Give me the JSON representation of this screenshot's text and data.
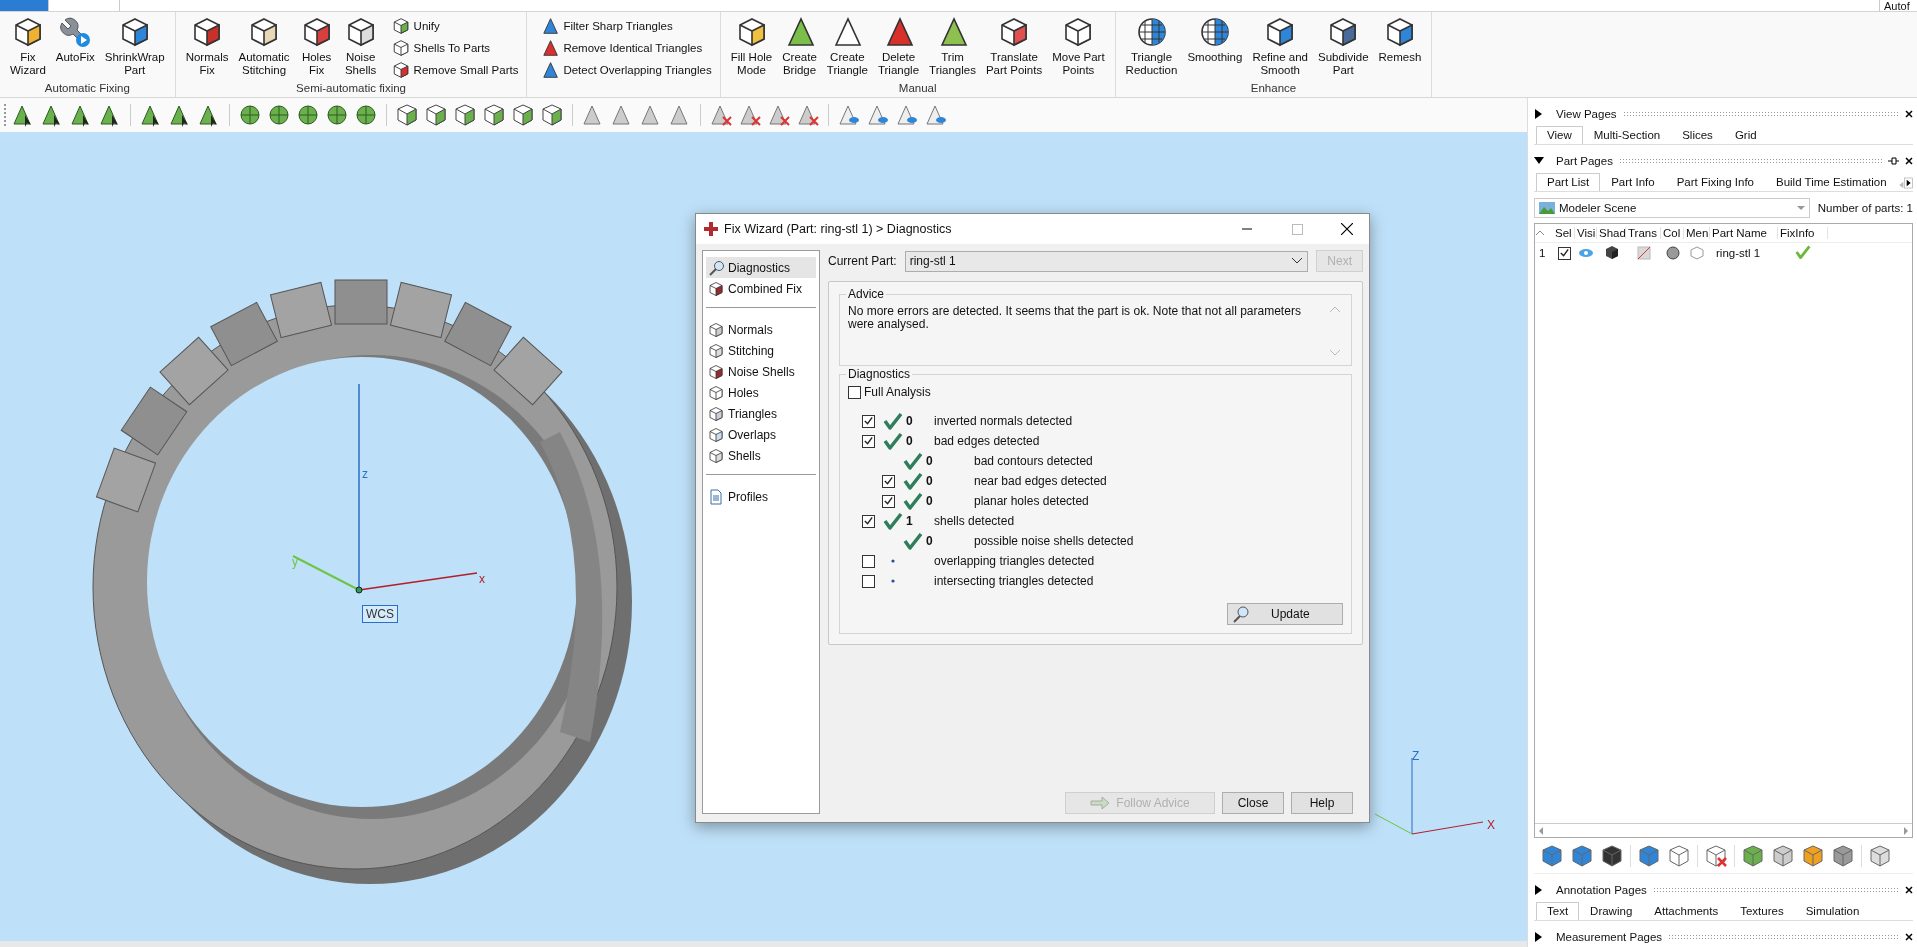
{
  "top_tab": "Autof",
  "ribbon": {
    "groups": [
      {
        "label": "Automatic Fixing",
        "buttons": [
          "Fix\nWizard",
          "AutoFix",
          "ShrinkWrap\nPart"
        ]
      },
      {
        "label": "Semi-automatic fixing",
        "buttons": [
          "Normals\nFix",
          "Automatic\nStitching",
          "Holes\nFix",
          "Noise\nShells"
        ],
        "small_buttons": [
          "Unify",
          "Shells To Parts",
          "Remove Small Parts"
        ]
      },
      {
        "small_buttons": [
          "Filter Sharp Triangles",
          "Remove Identical Triangles",
          "Detect Overlapping Triangles"
        ]
      },
      {
        "label": "Manual",
        "buttons": [
          "Fill Hole\nMode",
          "Create\nBridge",
          "Create\nTriangle",
          "Delete\nTriangle",
          "Trim\nTriangles",
          "Translate\nPart Points",
          "Move Part\nPoints"
        ]
      },
      {
        "label": "Enhance",
        "buttons": [
          "Triangle\nReduction",
          "Smoothing",
          "Refine and\nSmooth",
          "Subdivide\nPart",
          "Remesh"
        ]
      }
    ]
  },
  "viewport": {
    "axes": {
      "z": "z",
      "y": "y",
      "x": "x",
      "origin": "WCS"
    },
    "mini_axes": {
      "z": "Z",
      "x": "X"
    }
  },
  "fix_wizard": {
    "title": "Fix Wizard (Part: ring-stl 1) > Diagnostics",
    "nav_groups": [
      {
        "items": [
          {
            "label": "Diagnostics",
            "selected": true
          },
          {
            "label": "Combined Fix",
            "selected": false
          }
        ]
      },
      {
        "items": [
          {
            "label": "Normals",
            "selected": false
          },
          {
            "label": "Stitching",
            "selected": false
          },
          {
            "label": "Noise Shells",
            "selected": false
          },
          {
            "label": "Holes",
            "selected": false
          },
          {
            "label": "Triangles",
            "selected": false
          },
          {
            "label": "Overlaps",
            "selected": false
          },
          {
            "label": "Shells",
            "selected": false
          }
        ]
      },
      {
        "items": [
          {
            "label": "Profiles",
            "selected": false
          }
        ]
      }
    ],
    "current_part": {
      "label": "Current Part:",
      "value": "ring-stl 1"
    },
    "next_button": {
      "label": "Next",
      "disabled": true
    },
    "advice": {
      "title": "Advice",
      "text": "No more errors are detected. It seems that the part is ok. Note that not all parameters were analysed."
    },
    "diagnostics": {
      "title": "Diagnostics",
      "full_analysis": {
        "label": "Full Analysis",
        "checked": false
      },
      "checks": [
        {
          "kind": "checkbox",
          "checked": true,
          "passed": true,
          "count": "0",
          "label": "inverted normals detected"
        },
        {
          "kind": "checkbox",
          "checked": true,
          "passed": true,
          "count": "0",
          "label": "bad edges detected",
          "children": [
            {
              "kind": "plain",
              "passed": true,
              "count": "0",
              "label": "bad contours detected"
            },
            {
              "kind": "checkbox",
              "checked": true,
              "passed": true,
              "count": "0",
              "label": "near bad edges detected"
            },
            {
              "kind": "checkbox",
              "checked": true,
              "passed": true,
              "count": "0",
              "label": "planar holes detected"
            }
          ]
        },
        {
          "kind": "checkbox",
          "checked": true,
          "passed": true,
          "count": "1",
          "label": "shells detected",
          "children": [
            {
              "kind": "plain",
              "passed": true,
              "count": "0",
              "label": "possible noise shells detected"
            }
          ]
        },
        {
          "kind": "checkbox",
          "checked": false,
          "passed": false,
          "label": "overlapping triangles detected"
        },
        {
          "kind": "checkbox",
          "checked": false,
          "passed": false,
          "label": "intersecting triangles detected"
        }
      ],
      "update_button": "Update"
    },
    "buttons": [
      {
        "label": "Follow Advice",
        "disabled": true
      },
      {
        "label": "Close",
        "disabled": false
      },
      {
        "label": "Help",
        "disabled": false
      }
    ]
  },
  "side_panel": {
    "sections": [
      {
        "title": "View Pages",
        "expanded": false,
        "tabs": [
          {
            "label": "View",
            "selected": true
          },
          {
            "label": "Multi-Section",
            "selected": false
          },
          {
            "label": "Slices",
            "selected": false
          },
          {
            "label": "Grid",
            "selected": false
          }
        ]
      },
      {
        "title": "Part Pages",
        "expanded": true,
        "tabs": [
          {
            "label": "Part List",
            "selected": true
          },
          {
            "label": "Part Info",
            "selected": false
          },
          {
            "label": "Part Fixing Info",
            "selected": false
          },
          {
            "label": "Build Time Estimation",
            "selected": false
          }
        ],
        "scene": "Modeler Scene",
        "parts_count": "Number of parts:  1",
        "columns": [
          "Sel",
          "Visi",
          "Shad",
          "Trans",
          "Col",
          "Men",
          "Part Name",
          "FixInfo"
        ],
        "rows": [
          {
            "index": "1",
            "checked": true,
            "name": "ring-stl 1",
            "fix_ok": true
          }
        ]
      },
      {
        "title": "Annotation Pages",
        "expanded": false,
        "tabs": [
          {
            "label": "Text",
            "selected": true
          },
          {
            "label": "Drawing",
            "selected": false
          },
          {
            "label": "Attachments",
            "selected": false
          },
          {
            "label": "Textures",
            "selected": false
          },
          {
            "label": "Simulation",
            "selected": false
          }
        ]
      },
      {
        "title": "Measurement Pages",
        "expanded": false
      }
    ]
  }
}
